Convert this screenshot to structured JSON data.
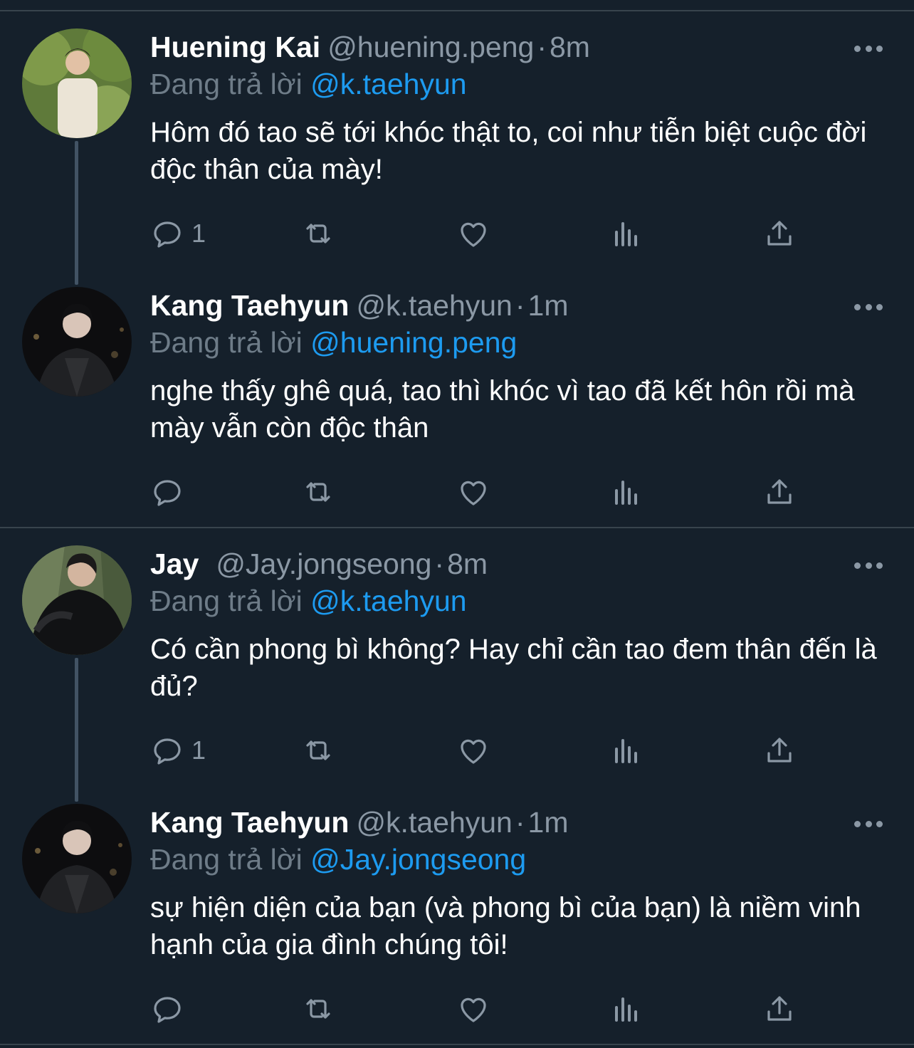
{
  "tweets": [
    {
      "name": "Huening Kai",
      "handle": "@huening.peng",
      "separator": "·",
      "time": "8m",
      "reply_prefix": "Đang trả lời",
      "reply_to": "@k.taehyun",
      "text": "Hôm đó tao sẽ tới khóc thật to, coi như tiễn biệt cuộc đời độc thân của mày!",
      "reply_count": "1"
    },
    {
      "name": "Kang Taehyun",
      "handle": "@k.taehyun",
      "separator": "·",
      "time": "1m",
      "reply_prefix": "Đang trả lời",
      "reply_to": "@huening.peng",
      "text": "nghe thấy ghê quá, tao thì khóc vì tao đã kết hôn rồi mà mày vẫn còn độc thân",
      "reply_count": ""
    },
    {
      "name": "Jay",
      "handle": "@Jay.jongseong",
      "separator": "·",
      "time": "8m",
      "reply_prefix": "Đang trả lời",
      "reply_to": "@k.taehyun",
      "text": "Có cần phong bì không? Hay chỉ cần tao đem thân đến là đủ?",
      "reply_count": "1"
    },
    {
      "name": "Kang Taehyun",
      "handle": "@k.taehyun",
      "separator": "·",
      "time": "1m",
      "reply_prefix": "Đang trả lời",
      "reply_to": "@Jay.jongseong",
      "text": "sự hiện diện của bạn (và phong bì của bạn) là niềm vinh hạnh của gia đình chúng tôi!",
      "reply_count": ""
    }
  ],
  "icons": {
    "reply": "reply-icon",
    "retweet": "retweet-icon",
    "like": "like-icon",
    "views": "views-icon",
    "share": "share-icon",
    "more": "more-icon"
  },
  "colors": {
    "background": "#15202b",
    "accent": "#1d9bf0",
    "muted": "#8b98a5",
    "divider": "#38444d"
  }
}
